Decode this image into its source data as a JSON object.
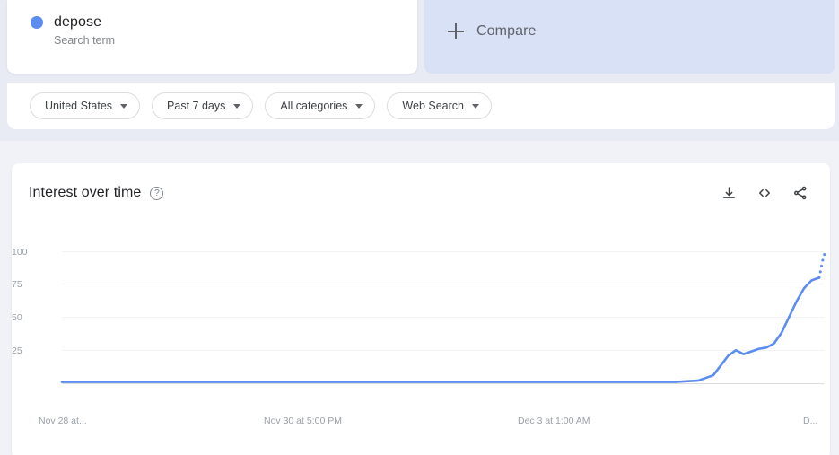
{
  "terms": {
    "primary": {
      "name": "depose",
      "subtitle": "Search term",
      "dot_color": "#5b8cf0",
      "dot_icon": "legend-dot-icon"
    },
    "compare": {
      "label": "Compare",
      "plus_icon": "plus-icon",
      "background": "#d8e1f5"
    }
  },
  "filters": [
    {
      "label": "United States",
      "caret_icon": "chevron-down-icon"
    },
    {
      "label": "Past 7 days",
      "caret_icon": "chevron-down-icon"
    },
    {
      "label": "All categories",
      "caret_icon": "chevron-down-icon"
    },
    {
      "label": "Web Search",
      "caret_icon": "chevron-down-icon"
    }
  ],
  "chart_panel": {
    "title": "Interest over time",
    "help_icon": "help-circle-icon",
    "help_glyph": "?",
    "actions": [
      {
        "name": "download-icon",
        "tooltip": "Download"
      },
      {
        "name": "embed-code-icon",
        "tooltip": "Embed"
      },
      {
        "name": "share-icon",
        "tooltip": "Share"
      }
    ]
  },
  "chart_data": {
    "type": "line",
    "title": "Interest over time",
    "xlabel": "",
    "ylabel": "",
    "ylim": [
      0,
      100
    ],
    "yticks": [
      100,
      75,
      50,
      25
    ],
    "grid": true,
    "legend_position": "top-card",
    "series_color": "#5b8cf0",
    "xtick_labels": [
      "Nov 28 at...",
      "Nov 30 at 5:00 PM",
      "Dec 3 at 1:00 AM",
      "D..."
    ],
    "series": [
      {
        "name": "depose",
        "color": "#5b8cf0",
        "partial_data_dotted_tail": true,
        "x": [
          0,
          3,
          6,
          9,
          12,
          15,
          18,
          21,
          24,
          27,
          30,
          33,
          36,
          39,
          42,
          45,
          48,
          51,
          54,
          57,
          60,
          63,
          66,
          69,
          72,
          75,
          78,
          81,
          84,
          86,
          88,
          89,
          90,
          91,
          92,
          93,
          94,
          95,
          96,
          97,
          98,
          99,
          100
        ],
        "values": [
          1,
          1,
          1,
          1,
          1,
          1,
          1,
          1,
          1,
          1,
          1,
          1,
          1,
          1,
          1,
          1,
          1,
          1,
          1,
          1,
          1,
          1,
          1,
          1,
          1,
          1,
          1,
          1,
          2,
          6,
          21,
          25,
          22,
          24,
          26,
          27,
          30,
          38,
          50,
          62,
          72,
          78,
          80
        ],
        "dotted_segment": {
          "x": [
            100,
            100.4,
            100.8
          ],
          "values": [
            80,
            92,
            100
          ]
        }
      }
    ]
  }
}
